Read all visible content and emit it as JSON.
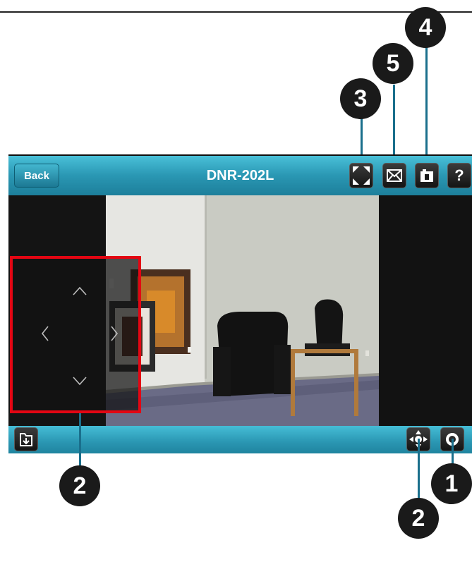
{
  "titlebar": {
    "back_label": "Back",
    "title": "DNR-202L",
    "buttons": [
      {
        "name": "fullscreen-button",
        "icon": "fullscreen-icon"
      },
      {
        "name": "email-button",
        "icon": "envelope-icon"
      },
      {
        "name": "snapshot-button",
        "icon": "camera-icon"
      },
      {
        "name": "help-button",
        "icon": "question-icon",
        "label": "?"
      }
    ]
  },
  "bottombar": {
    "left_button_icon": "folder-download-icon",
    "right_buttons": [
      {
        "name": "ptz-button",
        "icon": "ptz-arrows-icon"
      },
      {
        "name": "record-button",
        "icon": "record-icon"
      }
    ]
  },
  "ptz_overlay": {
    "arrows": [
      "up",
      "left",
      "right",
      "down"
    ]
  },
  "callouts": {
    "c1": "1",
    "c2_left": "2",
    "c2_right": "2",
    "c3": "3",
    "c4": "4",
    "c5": "5"
  },
  "colors": {
    "bar_teal": "#2a97b3",
    "highlight_red": "#e30613",
    "callout_fill": "#1a1a1a",
    "callout_line": "#1a6f8c"
  }
}
